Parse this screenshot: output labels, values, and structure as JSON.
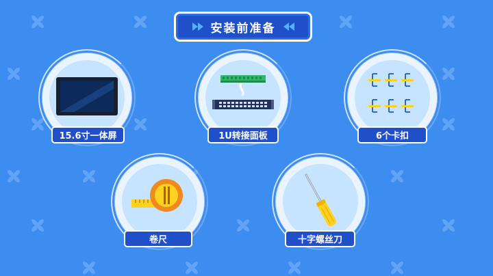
{
  "title": "安装前准备",
  "items": [
    {
      "label": "15.6寸一体屏",
      "icon": "monitor-icon"
    },
    {
      "label": "1U转接面板",
      "icon": "patch-panel-icon"
    },
    {
      "label": "6个卡扣",
      "icon": "clips-icon"
    },
    {
      "label": "卷尺",
      "icon": "tape-measure-icon"
    },
    {
      "label": "十字螺丝刀",
      "icon": "screwdriver-icon"
    }
  ],
  "colors": {
    "background": "#3d8cf0",
    "banner": "#1f4fc9",
    "circle_outer": "#e9f4ff",
    "circle_inner": "#c6e4ff",
    "accent_yellow": "#ffd21f",
    "accent_orange": "#f08a1e"
  }
}
